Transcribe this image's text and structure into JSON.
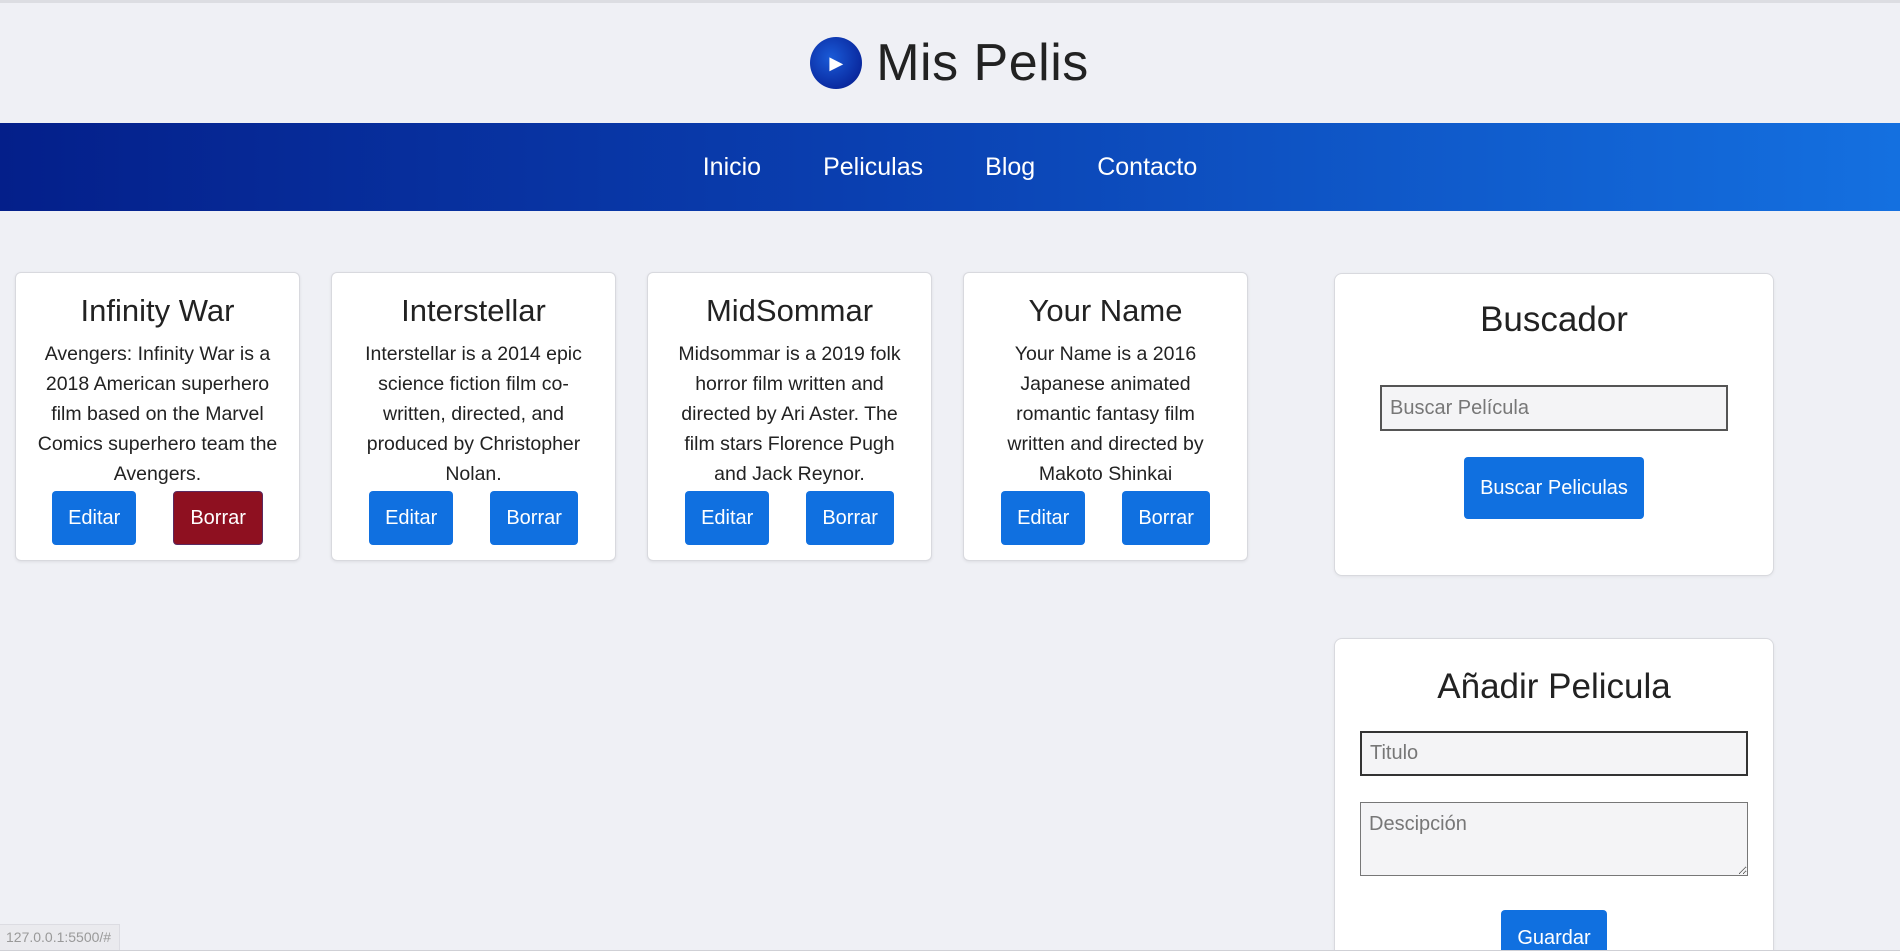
{
  "header": {
    "title": "Mis Pelis",
    "logo_icon": "play-icon"
  },
  "nav": {
    "items": [
      {
        "label": "Inicio"
      },
      {
        "label": "Peliculas"
      },
      {
        "label": "Blog"
      },
      {
        "label": "Contacto"
      }
    ]
  },
  "movies": [
    {
      "title": "Infinity War",
      "description": "Avengers: Infinity War is a 2018 American superhero film based on the Marvel Comics superhero team the Avengers.",
      "edit_label": "Editar",
      "delete_label": "Borrar"
    },
    {
      "title": "Interstellar",
      "description": "Interstellar is a 2014 epic science fiction film co-written, directed, and produced by Christopher Nolan.",
      "edit_label": "Editar",
      "delete_label": "Borrar"
    },
    {
      "title": "MidSommar",
      "description": "Midsommar is a 2019 folk horror film written and directed by Ari Aster. The film stars Florence Pugh and Jack Reynor.",
      "edit_label": "Editar",
      "delete_label": "Borrar"
    },
    {
      "title": "Your Name",
      "description": "Your Name is a 2016 Japanese animated romantic fantasy film written and directed by Makoto Shinkai",
      "edit_label": "Editar",
      "delete_label": "Borrar"
    }
  ],
  "search": {
    "heading": "Buscador",
    "placeholder": "Buscar Película",
    "button_label": "Buscar Peliculas"
  },
  "add_movie": {
    "heading": "Añadir Pelicula",
    "title_placeholder": "Titulo",
    "description_placeholder": "Descipción",
    "save_label": "Guardar"
  },
  "status_bar": {
    "url": "127.0.0.1:5500/#"
  },
  "colors": {
    "accent": "#1070e0",
    "danger": "#8e1020",
    "nav_start": "#041f8a",
    "nav_end": "#1470e0"
  }
}
